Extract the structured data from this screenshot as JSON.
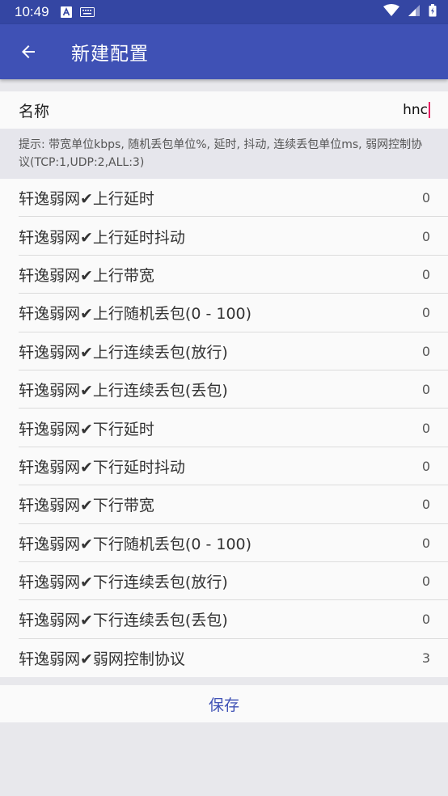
{
  "status_bar": {
    "time": "10:49"
  },
  "app_bar": {
    "title": "新建配置"
  },
  "name_field": {
    "label": "名称",
    "value": "hnc"
  },
  "hint": "提示: 带宽单位kbps, 随机丢包单位%, 延时, 抖动, 连续丢包单位ms, 弱网控制协议(TCP:1,UDP:2,ALL:3)",
  "settings": [
    {
      "label": "轩逸弱网✔上行延时",
      "value": "0"
    },
    {
      "label": "轩逸弱网✔上行延时抖动",
      "value": "0"
    },
    {
      "label": "轩逸弱网✔上行带宽",
      "value": "0"
    },
    {
      "label": "轩逸弱网✔上行随机丢包(0 - 100)",
      "value": "0"
    },
    {
      "label": "轩逸弱网✔上行连续丢包(放行)",
      "value": "0"
    },
    {
      "label": "轩逸弱网✔上行连续丢包(丢包)",
      "value": "0"
    },
    {
      "label": "轩逸弱网✔下行延时",
      "value": "0"
    },
    {
      "label": "轩逸弱网✔下行延时抖动",
      "value": "0"
    },
    {
      "label": "轩逸弱网✔下行带宽",
      "value": "0"
    },
    {
      "label": "轩逸弱网✔下行随机丢包(0 - 100)",
      "value": "0"
    },
    {
      "label": "轩逸弱网✔下行连续丢包(放行)",
      "value": "0"
    },
    {
      "label": "轩逸弱网✔下行连续丢包(丢包)",
      "value": "0"
    },
    {
      "label": "轩逸弱网✔弱网控制协议",
      "value": "3"
    }
  ],
  "save_label": "保存",
  "colors": {
    "status_bar": "#3446a3",
    "app_bar": "#3f51b5",
    "accent": "#3f51b5",
    "cursor": "#e91e63"
  }
}
